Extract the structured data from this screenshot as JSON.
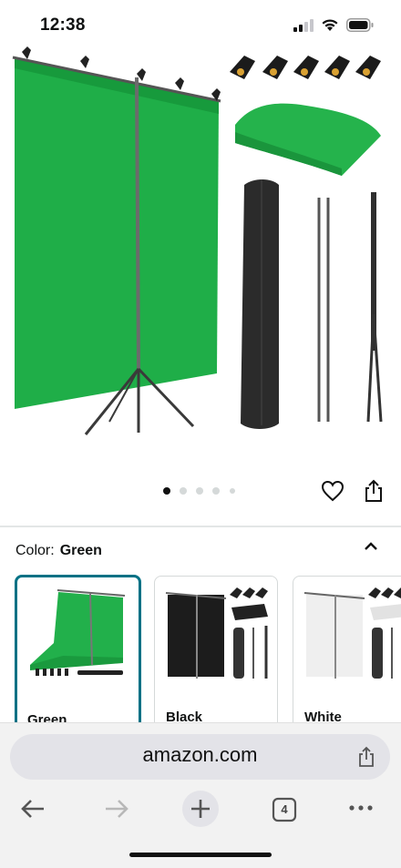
{
  "status_bar": {
    "time": "12:38"
  },
  "product": {
    "image_alt": "green screen backdrop stand kit",
    "carousel_total": 5,
    "carousel_active": 1
  },
  "variation": {
    "label": "Color:",
    "selected": "Green",
    "options": [
      {
        "name": "Green",
        "selected": true
      },
      {
        "name": "Black",
        "selected": false
      },
      {
        "name": "White",
        "selected": false
      }
    ]
  },
  "browser": {
    "url": "amazon.com",
    "tab_count": "4"
  },
  "colors": {
    "accent": "#007185",
    "screen_green": "#22b04b",
    "chrome_bg": "#f2f2f2"
  }
}
